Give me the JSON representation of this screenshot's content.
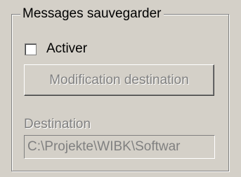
{
  "groupbox": {
    "title": "Messages sauvegarder"
  },
  "checkbox": {
    "label": "Activer",
    "checked": false
  },
  "button": {
    "label": "Modification destination",
    "enabled": false
  },
  "destination": {
    "label": "Destination",
    "value": "C:\\Projekte\\WIBK\\Softwar",
    "enabled": false
  },
  "colors": {
    "dialog_background": "#d4d0c8",
    "disabled_text": "#808080",
    "text": "#000000"
  }
}
